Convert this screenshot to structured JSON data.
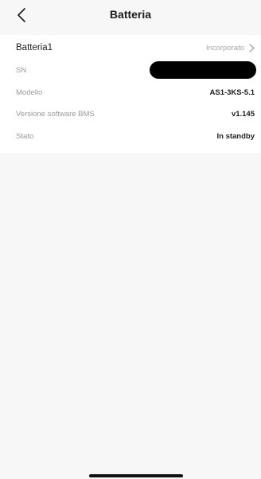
{
  "header": {
    "title": "Batteria"
  },
  "battery": {
    "name": "Batteria1",
    "link_label": "Incorporato"
  },
  "details": {
    "sn_label": "SN",
    "model_label": "Modello",
    "model_value": "AS1-3KS-5.1",
    "bms_label": "Versione software BMS",
    "bms_value": "v1.145",
    "state_label": "Stato",
    "state_value": "In standby"
  },
  "icons": {
    "back": "chevron-left-icon",
    "forward": "chevron-right-icon"
  }
}
